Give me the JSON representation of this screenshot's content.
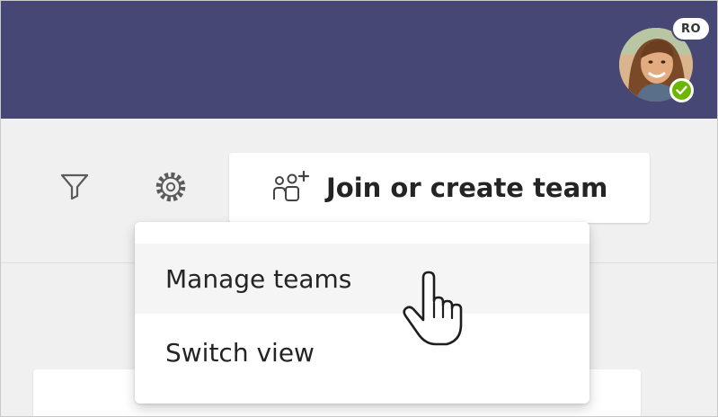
{
  "header": {
    "avatar_initials": "RO",
    "presence": "available",
    "colors": {
      "bar": "#464775",
      "presence": "#6bb700"
    }
  },
  "toolbar": {
    "filter_icon": "filter-icon",
    "settings_icon": "gear-icon",
    "join_button": {
      "icon": "add-people-icon",
      "label": "Join or create team"
    }
  },
  "menu": {
    "items": [
      {
        "label": "Manage teams",
        "hovered": true
      },
      {
        "label": "Switch view",
        "hovered": false
      }
    ]
  }
}
